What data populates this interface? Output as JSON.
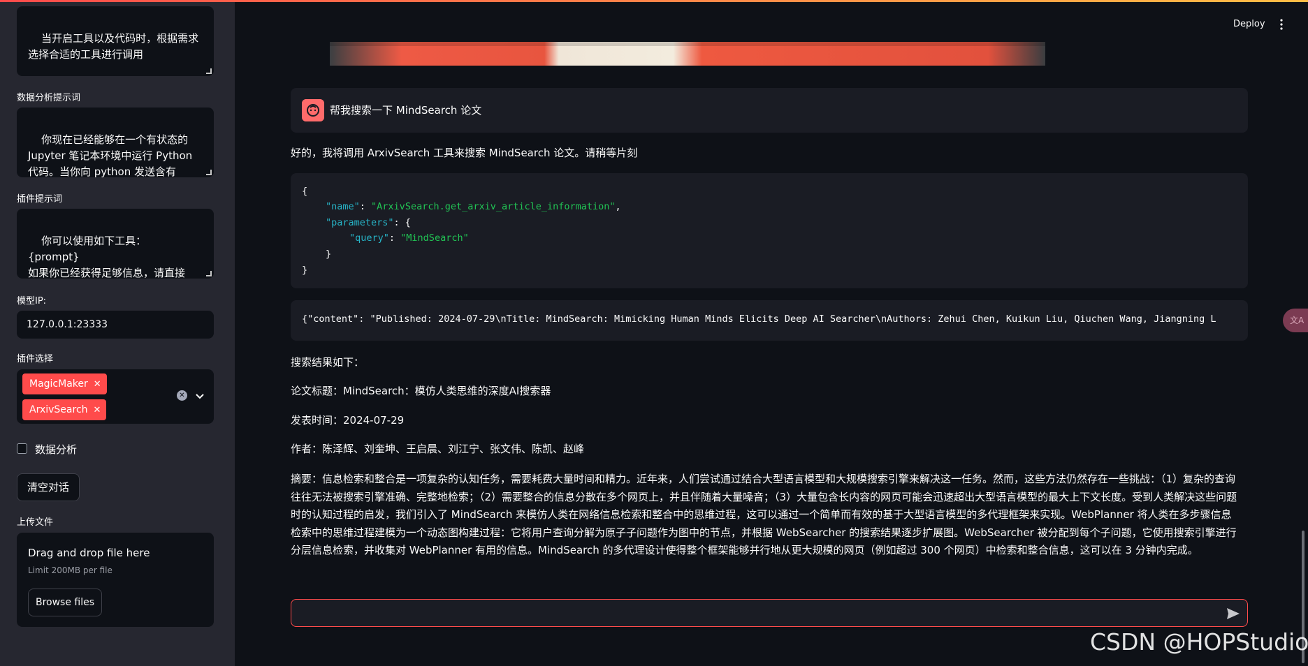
{
  "sidebar": {
    "tool_prompt_text": "当开启工具以及代码时，根据需求\n选择合适的工具进行调用",
    "data_analysis_label": "数据分析提示词",
    "data_analysis_text": "你现在已经能够在一个有状态的\nJupyter 笔记本环境中运行 Python\n代码。当你向 python 发送含有\nPython 代码的消息时，它将在该",
    "plugin_prompt_label": "插件提示词",
    "plugin_prompt_text": "你可以使用如下工具：\n{prompt}\n如果你已经获得足够信息，请直接\n给出答案. 避免不必要的工具调用!",
    "model_ip_label": "模型IP:",
    "model_ip_value": "127.0.0.1:23333",
    "plugin_select_label": "插件选择",
    "plugin_tags": [
      "MagicMaker",
      "ArxivSearch"
    ],
    "data_analysis_checkbox": "数据分析",
    "clear_chat_button": "清空对话",
    "upload_label": "上传文件",
    "upload_drop_text": "Drag and drop file here",
    "upload_limit_text": "Limit 200MB per file",
    "browse_button": "Browse files"
  },
  "header": {
    "deploy_label": "Deploy"
  },
  "chat": {
    "user_message": "帮我搜索一下 MindSearch 论文",
    "assistant_intro": "好的，我将调用 ArxivSearch 工具来搜索 MindSearch 论文。请稍等片刻",
    "tool_call": {
      "name_key": "\"name\"",
      "name_value": "\"ArxivSearch.get_arxiv_article_information\"",
      "params_key": "\"parameters\"",
      "query_key": "\"query\"",
      "query_value": "\"MindSearch\""
    },
    "tool_result": "{\"content\": \"Published: 2024-07-29\\nTitle: MindSearch: Mimicking Human Minds Elicits Deep AI Searcher\\nAuthors: Zehui Chen, Kuikun Liu, Qiuchen Wang, Jiangning L",
    "results_heading": "搜索结果如下：",
    "paper_title_line": "论文标题：MindSearch：模仿人类思维的深度AI搜索器",
    "publish_line": "发表时间：2024-07-29",
    "authors_line": "作者：陈泽辉、刘奎坤、王启晨、刘江宁、张文伟、陈凯、赵峰",
    "abstract": "摘要：信息检索和整合是一项复杂的认知任务，需要耗费大量时间和精力。近年来，人们尝试通过结合大型语言模型和大规模搜索引擎来解决这一任务。然而，这些方法仍然存在一些挑战：（1）复杂的查询往往无法被搜索引擎准确、完整地检索；（2）需要整合的信息分散在多个网页上，并且伴随着大量噪音；（3）大量包含长内容的网页可能会迅速超出大型语言模型的最大上下文长度。受到人类解决这些问题时的认知过程的启发，我们引入了 MindSearch 来模仿人类在网络信息检索和整合中的思维过程，这可以通过一个简单而有效的基于大型语言模型的多代理框架来实现。WebPlanner 将人类在多步骤信息检索中的思维过程建模为一个动态图构建过程：它将用户查询分解为原子子问题作为图中的节点，并根据 WebSearcher 的搜索结果逐步扩展图。WebSearcher 被分配到每个子问题，它使用搜索引擎进行分层信息检索，并收集对 WebPlanner 有用的信息。MindSearch 的多代理设计使得整个框架能够并行地从更大规模的网页（例如超过 300 个网页）中检索和整合信息，这可以在 3 分钟内完成。"
  },
  "watermark": "CSDN @HOPStudio",
  "translate_badge": "文A",
  "colors": {
    "accent": "#ff4b4b",
    "background": "#0e1117",
    "sidebar": "#262730",
    "json_key": "#27b4c7",
    "json_string": "#21c354"
  }
}
